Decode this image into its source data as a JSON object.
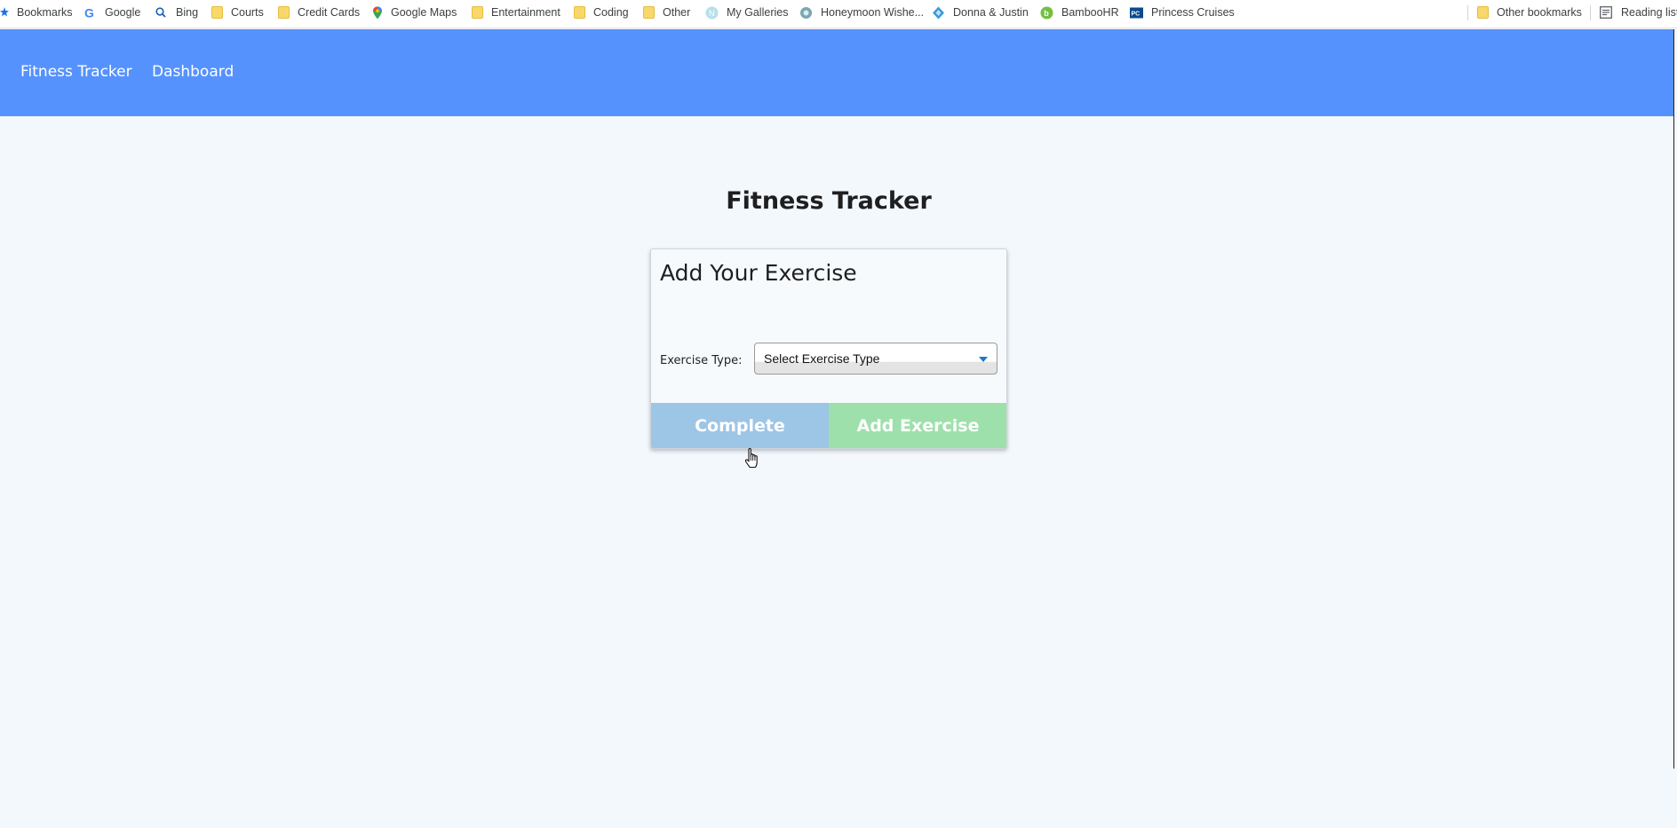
{
  "bookmarks": {
    "items": [
      {
        "label": "Bookmarks",
        "icon": "star-icon"
      },
      {
        "label": "Google",
        "icon": "google-icon"
      },
      {
        "label": "Bing",
        "icon": "bing-search-icon"
      },
      {
        "label": "Courts",
        "icon": "folder-icon"
      },
      {
        "label": "Credit Cards",
        "icon": "folder-icon"
      },
      {
        "label": "Google Maps",
        "icon": "maps-pin-icon"
      },
      {
        "label": "Entertainment",
        "icon": "folder-icon"
      },
      {
        "label": "Coding",
        "icon": "folder-icon"
      },
      {
        "label": "Other",
        "icon": "folder-icon"
      },
      {
        "label": "My Galleries",
        "icon": "gallery-icon"
      },
      {
        "label": "Honeymoon Wishe...",
        "icon": "honeymoon-icon"
      },
      {
        "label": "Donna & Justin",
        "icon": "diamond-icon"
      },
      {
        "label": "BambooHR",
        "icon": "bamboohr-icon"
      },
      {
        "label": "Princess Cruises",
        "icon": "princess-cruises-icon"
      }
    ],
    "other_bookmarks": "Other bookmarks",
    "reading_list": "Reading list"
  },
  "navbar": {
    "brand": "Fitness Tracker",
    "dashboard": "Dashboard",
    "color": "#5592fe"
  },
  "main": {
    "title": "Fitness Tracker"
  },
  "card": {
    "title": "Add Your Exercise",
    "exercise_type_label": "Exercise Type:",
    "exercise_type_selected": "Select Exercise Type",
    "complete_label": "Complete",
    "add_exercise_label": "Add Exercise"
  },
  "colors": {
    "background": "#f3f8fd",
    "complete_button": "#9dc5e6",
    "add_button": "#9ee0ab"
  }
}
